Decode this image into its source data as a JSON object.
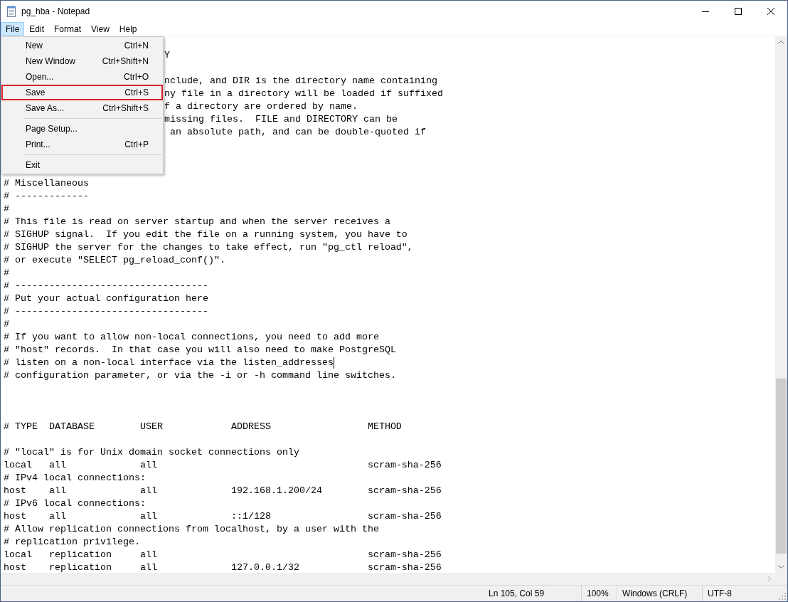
{
  "window": {
    "title": "pg_hba - Notepad"
  },
  "menu_bar": [
    {
      "label": "File",
      "selected": true
    },
    {
      "label": "Edit",
      "selected": false
    },
    {
      "label": "Format",
      "selected": false
    },
    {
      "label": "View",
      "selected": false
    },
    {
      "label": "Help",
      "selected": false
    }
  ],
  "file_menu": {
    "items": [
      {
        "kind": "item",
        "label": "New",
        "shortcut": "Ctrl+N",
        "highlighted": false
      },
      {
        "kind": "item",
        "label": "New Window",
        "shortcut": "Ctrl+Shift+N",
        "highlighted": false
      },
      {
        "kind": "item",
        "label": "Open...",
        "shortcut": "Ctrl+O",
        "highlighted": false
      },
      {
        "kind": "item",
        "label": "Save",
        "shortcut": "Ctrl+S",
        "highlighted": true
      },
      {
        "kind": "item",
        "label": "Save As...",
        "shortcut": "Ctrl+Shift+S",
        "highlighted": false
      },
      {
        "kind": "separator"
      },
      {
        "kind": "item",
        "label": "Page Setup...",
        "highlighted": false
      },
      {
        "kind": "item",
        "label": "Print...",
        "shortcut": "Ctrl+P",
        "highlighted": false
      },
      {
        "kind": "separator"
      },
      {
        "kind": "item",
        "label": "Exit",
        "highlighted": false
      }
    ]
  },
  "editor": {
    "lines": [
      {
        "kind": "blank",
        "caret": false
      },
      {
        "kind": "partial",
        "text": "Y",
        "caret": false
      },
      {
        "kind": "blank",
        "caret": false
      },
      {
        "kind": "partial",
        "text": "nclude, and DIR is the directory name containing",
        "caret": false
      },
      {
        "kind": "partial",
        "text": "ny file in a directory will be loaded if suffixed",
        "caret": false
      },
      {
        "kind": "partial",
        "text": "f a directory are ordered by name.",
        "caret": false
      },
      {
        "kind": "partial",
        "text": "missing files.  FILE and DIRECTORY can be",
        "caret": false
      },
      {
        "kind": "partial",
        "text": " an absolute path, and can be double-quoted if",
        "caret": false
      },
      {
        "kind": "blank",
        "caret": false
      },
      {
        "kind": "blank",
        "caret": false
      },
      {
        "kind": "blank",
        "caret": false
      },
      {
        "kind": "text",
        "text": "# Miscellaneous",
        "caret": false
      },
      {
        "kind": "text",
        "text": "# -------------",
        "caret": false
      },
      {
        "kind": "text",
        "text": "#",
        "caret": false
      },
      {
        "kind": "text",
        "text": "# This file is read on server startup and when the server receives a",
        "caret": false
      },
      {
        "kind": "text",
        "text": "# SIGHUP signal.  If you edit the file on a running system, you have to",
        "caret": false
      },
      {
        "kind": "text",
        "text": "# SIGHUP the server for the changes to take effect, run \"pg_ctl reload\",",
        "caret": false
      },
      {
        "kind": "text",
        "text": "# or execute \"SELECT pg_reload_conf()\".",
        "caret": false
      },
      {
        "kind": "text",
        "text": "#",
        "caret": false
      },
      {
        "kind": "text",
        "text": "# ----------------------------------",
        "caret": false
      },
      {
        "kind": "text",
        "text": "# Put your actual configuration here",
        "caret": false
      },
      {
        "kind": "text",
        "text": "# ----------------------------------",
        "caret": false
      },
      {
        "kind": "text",
        "text": "#",
        "caret": false
      },
      {
        "kind": "text",
        "text": "# If you want to allow non-local connections, you need to add more",
        "caret": false
      },
      {
        "kind": "text",
        "text": "# \"host\" records.  In that case you will also need to make PostgreSQL",
        "caret": false
      },
      {
        "kind": "text",
        "text": "# listen on a non-local interface via the listen_addresses",
        "caret": true
      },
      {
        "kind": "text",
        "text": "# configuration parameter, or via the -i or -h command line switches.",
        "caret": false
      },
      {
        "kind": "blank",
        "caret": false
      },
      {
        "kind": "blank",
        "caret": false
      },
      {
        "kind": "blank",
        "caret": false
      },
      {
        "kind": "text",
        "text": "# TYPE  DATABASE        USER            ADDRESS                 METHOD",
        "caret": false
      },
      {
        "kind": "blank",
        "caret": false
      },
      {
        "kind": "text",
        "text": "# \"local\" is for Unix domain socket connections only",
        "caret": false
      },
      {
        "kind": "text",
        "text": "local   all             all                                     scram-sha-256",
        "caret": false
      },
      {
        "kind": "text",
        "text": "# IPv4 local connections:",
        "caret": false
      },
      {
        "kind": "text",
        "text": "host    all             all             192.168.1.200/24        scram-sha-256",
        "caret": false
      },
      {
        "kind": "text",
        "text": "# IPv6 local connections:",
        "caret": false
      },
      {
        "kind": "text",
        "text": "host    all             all             ::1/128                 scram-sha-256",
        "caret": false
      },
      {
        "kind": "text",
        "text": "# Allow replication connections from localhost, by a user with the",
        "caret": false
      },
      {
        "kind": "text",
        "text": "# replication privilege.",
        "caret": false
      },
      {
        "kind": "text",
        "text": "local   replication     all                                     scram-sha-256",
        "caret": false
      },
      {
        "kind": "text",
        "text": "host    replication     all             127.0.0.1/32            scram-sha-256",
        "caret": false
      }
    ]
  },
  "status_bar": {
    "position": "Ln 105, Col 59",
    "zoom": "100%",
    "line_ending": "Windows (CRLF)",
    "encoding": "UTF-8"
  }
}
